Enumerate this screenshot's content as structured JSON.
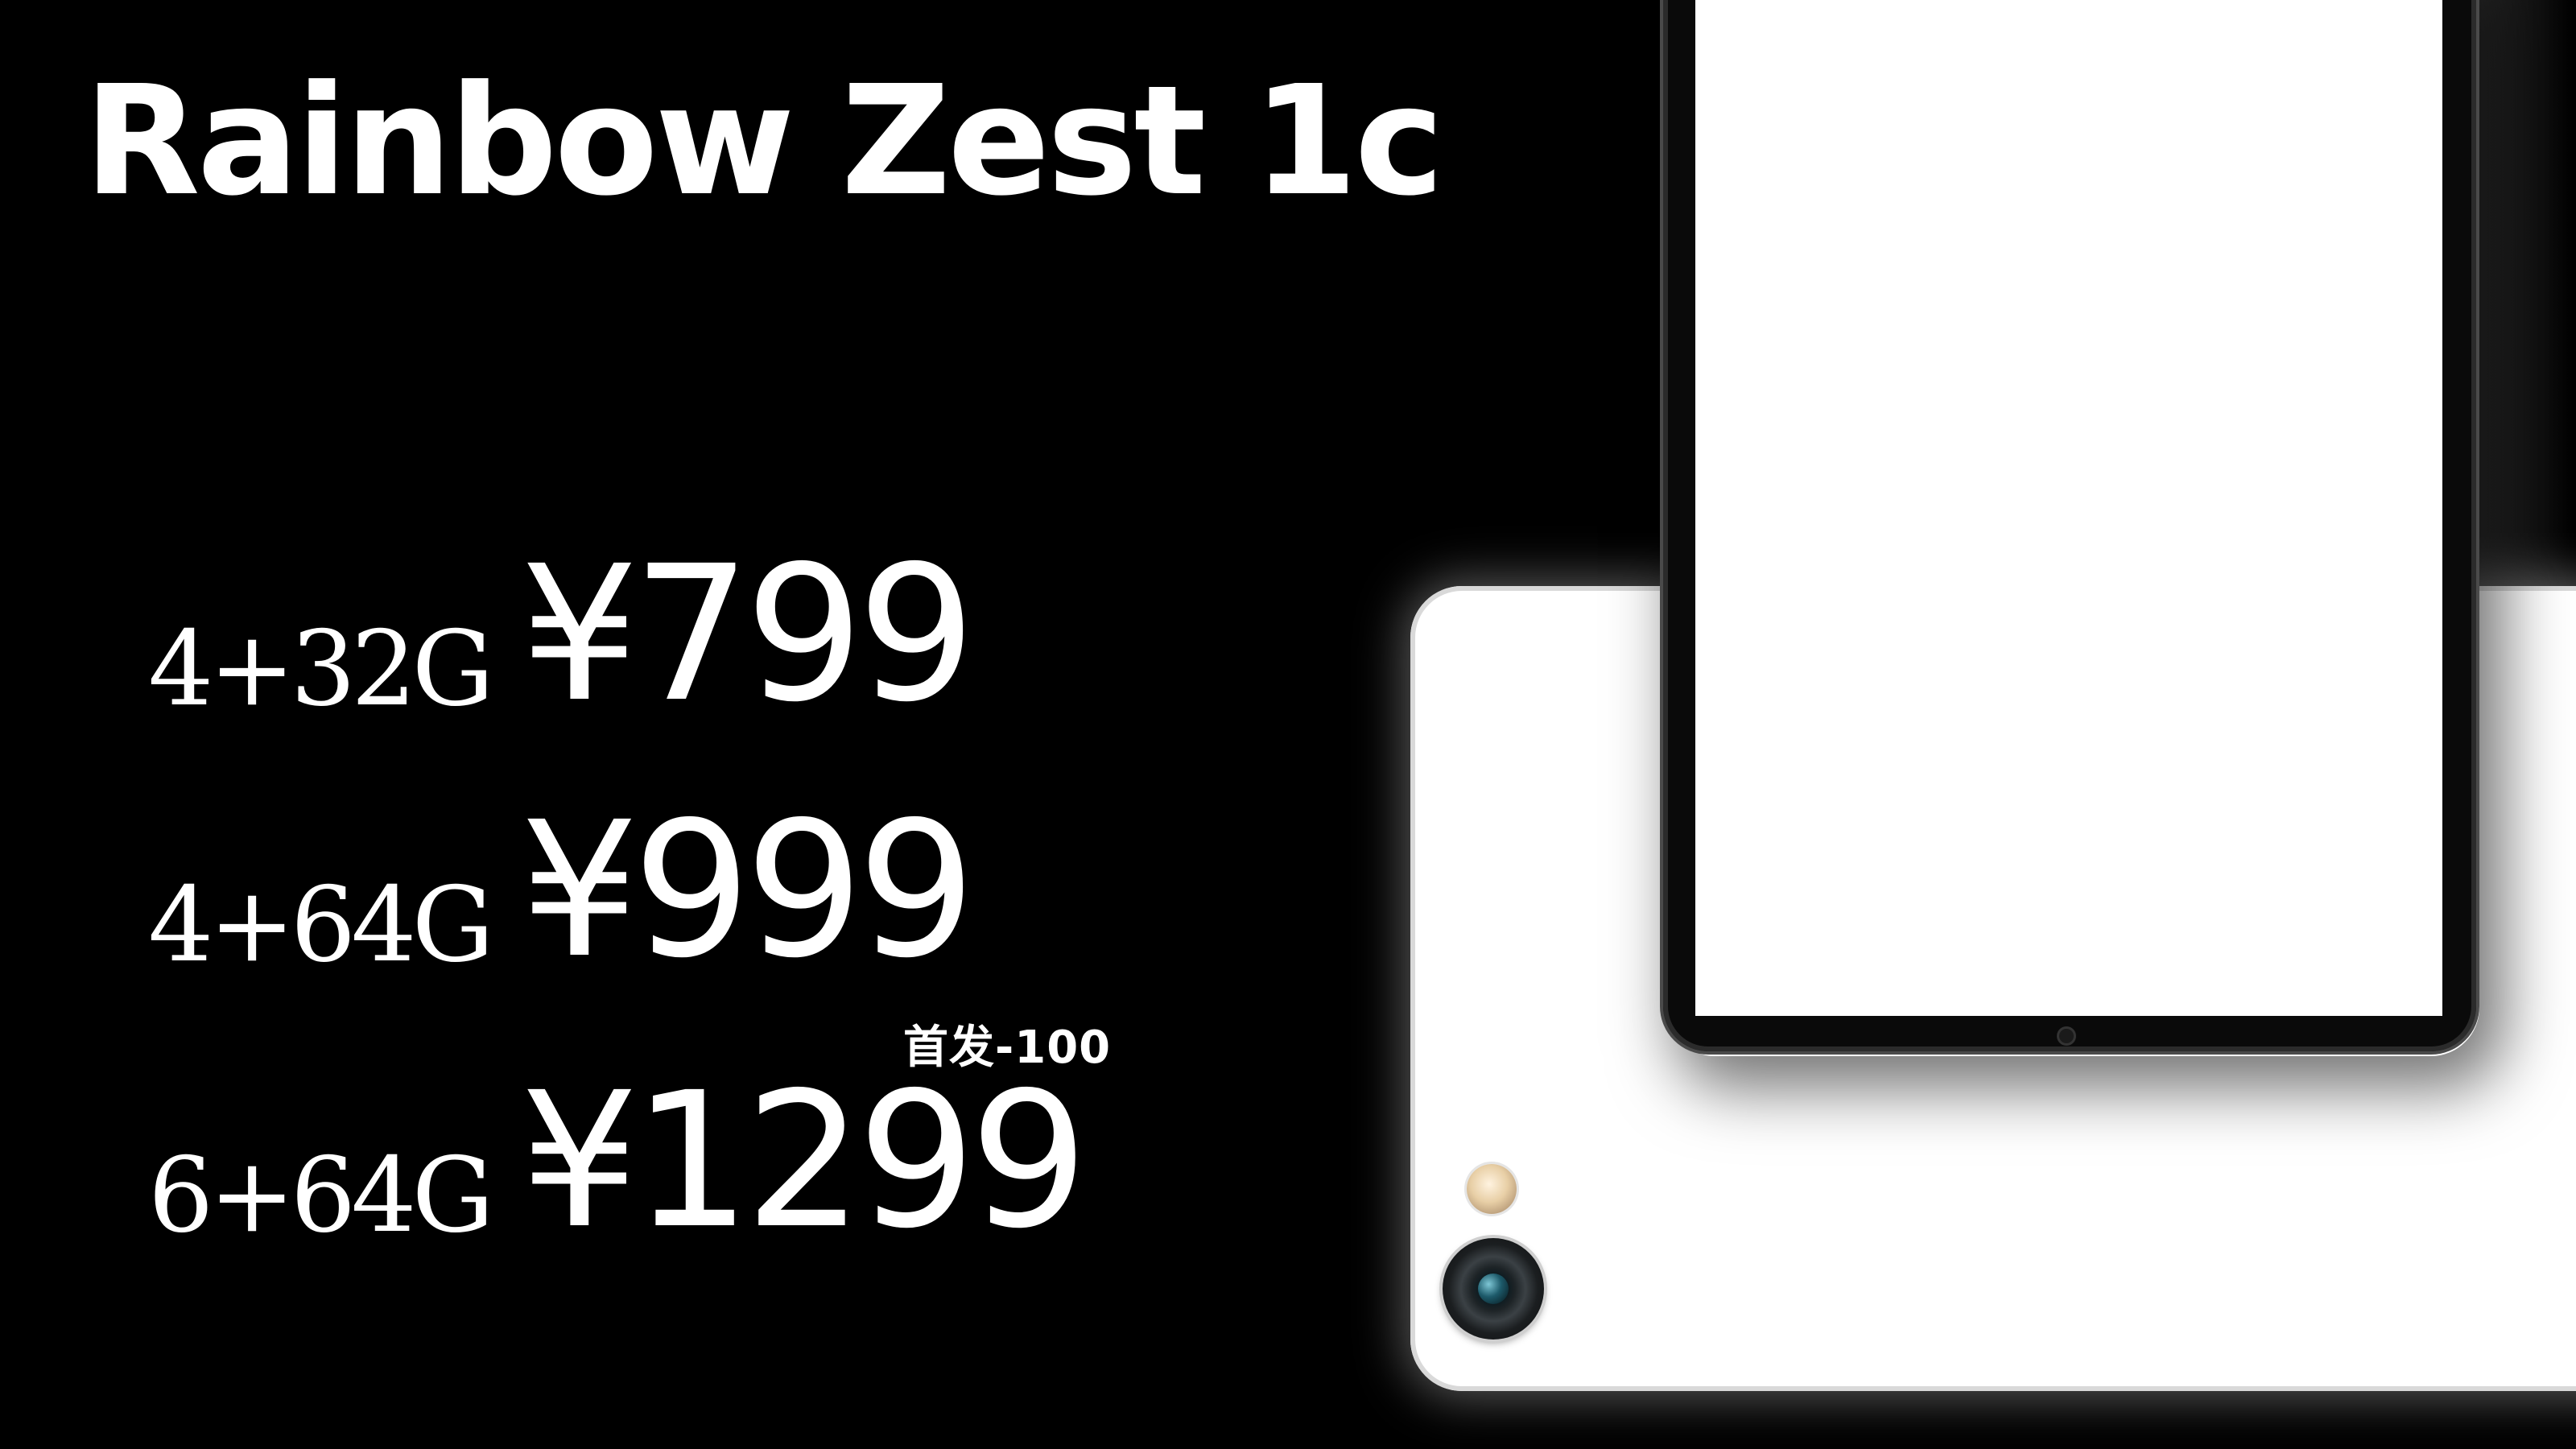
{
  "title": "Rainbow Zest 1c",
  "prices": [
    {
      "spec": "4+32G",
      "price": "¥799"
    },
    {
      "spec": "4+64G",
      "price": "¥999"
    },
    {
      "spec": "6+64G",
      "price": "¥1299"
    }
  ],
  "promo": "首发-100",
  "colors": {
    "background": "#000000",
    "text": "#ffffff",
    "device_body": "#ffffff"
  }
}
